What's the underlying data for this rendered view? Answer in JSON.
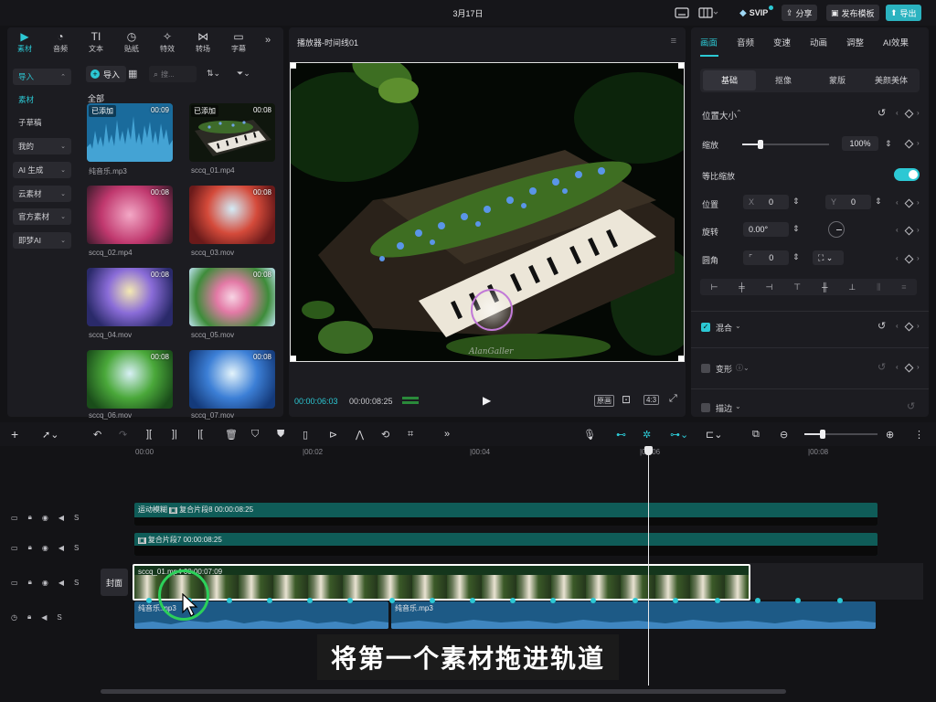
{
  "topbar": {
    "date": "3月17日",
    "svip": "SVIP",
    "share": "分享",
    "publish": "发布模板",
    "export": "导出"
  },
  "media_tabs": [
    {
      "label": "素材",
      "icon": "media-icon"
    },
    {
      "label": "音频",
      "icon": "audio-icon"
    },
    {
      "label": "文本",
      "icon": "text-icon"
    },
    {
      "label": "贴纸",
      "icon": "sticker-icon"
    },
    {
      "label": "特效",
      "icon": "effects-icon"
    },
    {
      "label": "转场",
      "icon": "transition-icon"
    },
    {
      "label": "字幕",
      "icon": "subtitle-icon"
    }
  ],
  "categories": [
    {
      "label": "导入",
      "expand": "^"
    },
    {
      "label": "素材",
      "expand": ""
    },
    {
      "label": "子草稿",
      "expand": ""
    },
    {
      "label": "我的",
      "expand": "v"
    },
    {
      "label": "AI 生成",
      "expand": "v"
    },
    {
      "label": "云素材",
      "expand": "v"
    },
    {
      "label": "官方素材",
      "expand": "v"
    },
    {
      "label": "即梦AI",
      "expand": "v"
    }
  ],
  "media_toolbar": {
    "import": "导入",
    "search_placeholder": "搜...",
    "section": "全部"
  },
  "media_items": [
    {
      "name": "纯音乐.mp3",
      "duration": "00:09",
      "badge": "已添加"
    },
    {
      "name": "sccq_01.mp4",
      "duration": "00:08",
      "badge": "已添加"
    },
    {
      "name": "sccq_02.mp4",
      "duration": "00:08",
      "badge": ""
    },
    {
      "name": "sccq_03.mov",
      "duration": "00:08",
      "badge": ""
    },
    {
      "name": "sccq_04.mov",
      "duration": "00:08",
      "badge": ""
    },
    {
      "name": "sccq_05.mov",
      "duration": "00:08",
      "badge": ""
    },
    {
      "name": "sccq_06.mov",
      "duration": "00:08",
      "badge": ""
    },
    {
      "name": "sccq_07.mov",
      "duration": "00:08",
      "badge": ""
    }
  ],
  "player": {
    "title": "播放器-时间线01",
    "current": "00:00:06:03",
    "total": "00:00:08:25",
    "original": "原画",
    "ratio": "4:3",
    "watermark": "AlanGaller"
  },
  "right_tabs": [
    "画面",
    "音频",
    "变速",
    "动画",
    "调整",
    "AI效果"
  ],
  "sub_tabs": [
    "基础",
    "抠像",
    "蒙版",
    "美颜美体"
  ],
  "props": {
    "pos_size": "位置大小",
    "scale": "缩放",
    "scale_val": "100%",
    "uniform": "等比缩放",
    "position": "位置",
    "x_label": "X",
    "x_val": "0",
    "y_label": "Y",
    "y_val": "0",
    "rotate": "旋转",
    "rotate_val": "0.00°",
    "corner": "圆角",
    "corner_val": "0",
    "blend": "混合",
    "transform": "变形",
    "stroke": "描边"
  },
  "ruler": [
    "00:00",
    "|00:02",
    "|00:04",
    "|00:06",
    "|00:08"
  ],
  "tracks": {
    "cover": "封面",
    "blur_clip": {
      "name": "运动模糊",
      "compound": "复合片段8",
      "time": "00:00:08:25"
    },
    "compound_clip": {
      "name": "复合片段7",
      "time": "00:00:08:25"
    },
    "video_clip": {
      "name": "sccq_01.mp4",
      "time": "00:00:07:09"
    },
    "audio_a": "纯音乐.mp3",
    "audio_b": "纯音乐.mp3"
  },
  "subtitle": "将第一个素材拖进轨道",
  "colors": {
    "accent": "#2cc8d4",
    "track_teal": "#0f5c58",
    "audio_blue": "#1d5a86",
    "bg": "#131316"
  }
}
